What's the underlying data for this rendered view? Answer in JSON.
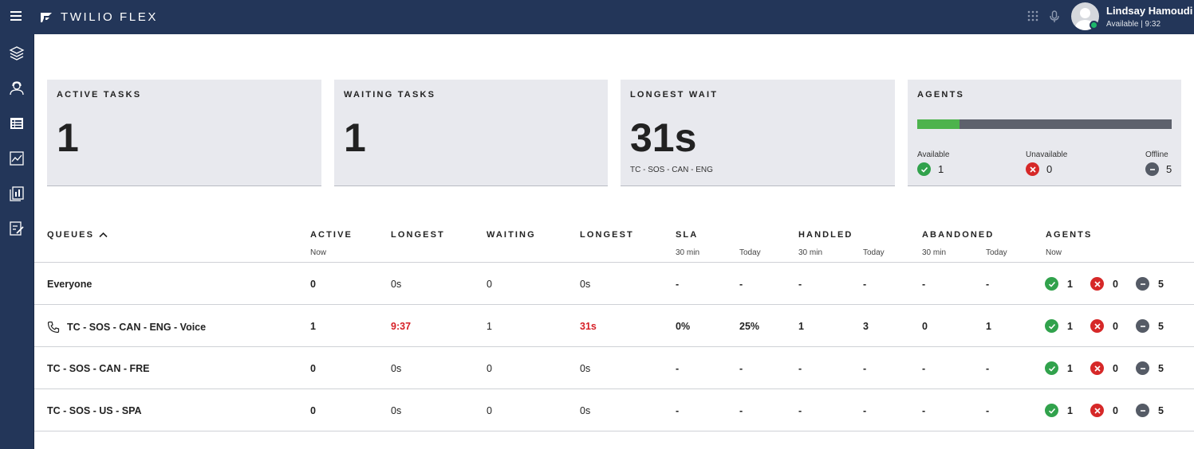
{
  "app": {
    "title": "TWILIO FLEX"
  },
  "user": {
    "name": "Lindsay Hamoudi",
    "status": "Available | 9:32"
  },
  "sidebar": {
    "items": [
      "layers-icon",
      "agents-icon",
      "queues-icon",
      "analytics-icon",
      "reports-icon",
      "tasks-icon"
    ]
  },
  "tiles": {
    "active": {
      "label": "ACTIVE TASKS",
      "value": "1"
    },
    "waiting": {
      "label": "WAITING TASKS",
      "value": "1"
    },
    "longest": {
      "label": "LONGEST WAIT",
      "value": "31s",
      "queue": "TC - SOS - CAN - ENG"
    },
    "agents": {
      "label": "AGENTS",
      "available_fraction": 0.1667,
      "available_label": "Available",
      "available_value": "1",
      "unavailable_label": "Unavailable",
      "unavailable_value": "0",
      "offline_label": "Offline",
      "offline_value": "5"
    }
  },
  "table": {
    "headers": {
      "queues": "QUEUES",
      "active": "ACTIVE",
      "longest1": "LONGEST",
      "waiting": "WAITING",
      "longest2": "LONGEST",
      "sla": "SLA",
      "handled": "HANDLED",
      "abandoned": "ABANDONED",
      "agents": "AGENTS"
    },
    "subheaders": {
      "active_now": "Now",
      "sla_30": "30 min",
      "sla_today": "Today",
      "handled_30": "30 min",
      "handled_today": "Today",
      "abandoned_30": "30 min",
      "abandoned_today": "Today",
      "agents_now": "Now"
    },
    "rows": [
      {
        "name": "Everyone",
        "active": "0",
        "longest_active": "0s",
        "waiting": "0",
        "longest_waiting": "0s",
        "sla_30": "-",
        "sla_today": "-",
        "handled_30": "-",
        "handled_today": "-",
        "abandoned_30": "-",
        "abandoned_today": "-",
        "agents_available": "1",
        "agents_unavailable": "0",
        "agents_offline": "5"
      },
      {
        "name": "TC - SOS - CAN - ENG - Voice",
        "active": "1",
        "longest_active": "9:37",
        "waiting": "1",
        "longest_waiting": "31s",
        "sla_30": "0%",
        "sla_today": "25%",
        "handled_30": "1",
        "handled_today": "3",
        "abandoned_30": "0",
        "abandoned_today": "1",
        "agents_available": "1",
        "agents_unavailable": "0",
        "agents_offline": "5"
      },
      {
        "name": "TC - SOS - CAN - FRE",
        "active": "0",
        "longest_active": "0s",
        "waiting": "0",
        "longest_waiting": "0s",
        "sla_30": "-",
        "sla_today": "-",
        "handled_30": "-",
        "handled_today": "-",
        "abandoned_30": "-",
        "abandoned_today": "-",
        "agents_available": "1",
        "agents_unavailable": "0",
        "agents_offline": "5"
      },
      {
        "name": "TC - SOS - US - SPA",
        "active": "0",
        "longest_active": "0s",
        "waiting": "0",
        "longest_waiting": "0s",
        "sla_30": "-",
        "sla_today": "-",
        "handled_30": "-",
        "handled_today": "-",
        "abandoned_30": "-",
        "abandoned_today": "-",
        "agents_available": "1",
        "agents_unavailable": "0",
        "agents_offline": "5"
      }
    ]
  },
  "colors": {
    "topbar": "#233659",
    "available": "#31a24c",
    "unavailable": "#d62828",
    "offline": "#555b66",
    "alert": "#d61f26"
  }
}
